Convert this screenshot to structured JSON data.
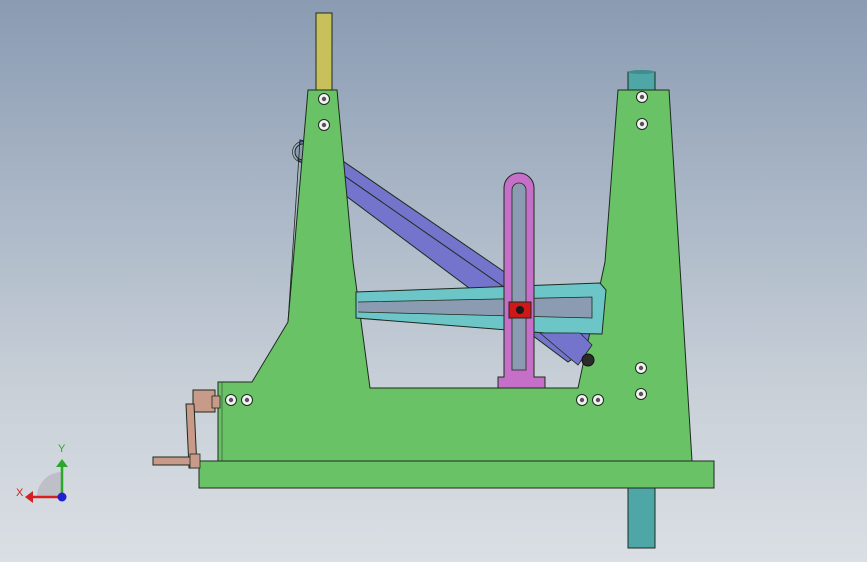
{
  "viewport": {
    "background_top": "#8a9bb2",
    "background_bottom": "#dadfe4"
  },
  "model": {
    "colors": {
      "frame": "#6ac267",
      "frame_edge": "#1d2a1d",
      "link": "#7474cc",
      "slide_plate": "#6cc6c8",
      "slot_guide": "#c56fc8",
      "slider_block": "#d01818",
      "crank": "#c89a8a",
      "rod_top": "#c8c05a",
      "rod_right": "#4fa6a6",
      "bolt": "#f3f3f3"
    }
  },
  "triad": {
    "x_label": "X",
    "y_label": "Y",
    "x_color": "#d42020",
    "y_color": "#2aa82a",
    "z_color": "#2020d0"
  }
}
